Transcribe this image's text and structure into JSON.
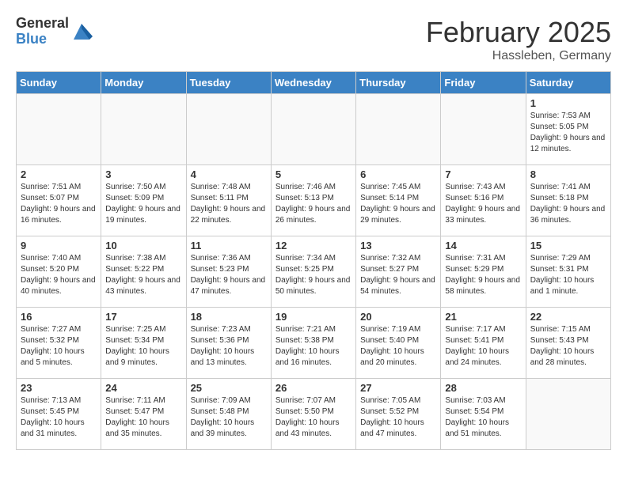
{
  "header": {
    "logo_general": "General",
    "logo_blue": "Blue",
    "month_title": "February 2025",
    "location": "Hassleben, Germany"
  },
  "weekdays": [
    "Sunday",
    "Monday",
    "Tuesday",
    "Wednesday",
    "Thursday",
    "Friday",
    "Saturday"
  ],
  "weeks": [
    [
      {
        "day": "",
        "info": ""
      },
      {
        "day": "",
        "info": ""
      },
      {
        "day": "",
        "info": ""
      },
      {
        "day": "",
        "info": ""
      },
      {
        "day": "",
        "info": ""
      },
      {
        "day": "",
        "info": ""
      },
      {
        "day": "1",
        "info": "Sunrise: 7:53 AM\nSunset: 5:05 PM\nDaylight: 9 hours and 12 minutes."
      }
    ],
    [
      {
        "day": "2",
        "info": "Sunrise: 7:51 AM\nSunset: 5:07 PM\nDaylight: 9 hours and 16 minutes."
      },
      {
        "day": "3",
        "info": "Sunrise: 7:50 AM\nSunset: 5:09 PM\nDaylight: 9 hours and 19 minutes."
      },
      {
        "day": "4",
        "info": "Sunrise: 7:48 AM\nSunset: 5:11 PM\nDaylight: 9 hours and 22 minutes."
      },
      {
        "day": "5",
        "info": "Sunrise: 7:46 AM\nSunset: 5:13 PM\nDaylight: 9 hours and 26 minutes."
      },
      {
        "day": "6",
        "info": "Sunrise: 7:45 AM\nSunset: 5:14 PM\nDaylight: 9 hours and 29 minutes."
      },
      {
        "day": "7",
        "info": "Sunrise: 7:43 AM\nSunset: 5:16 PM\nDaylight: 9 hours and 33 minutes."
      },
      {
        "day": "8",
        "info": "Sunrise: 7:41 AM\nSunset: 5:18 PM\nDaylight: 9 hours and 36 minutes."
      }
    ],
    [
      {
        "day": "9",
        "info": "Sunrise: 7:40 AM\nSunset: 5:20 PM\nDaylight: 9 hours and 40 minutes."
      },
      {
        "day": "10",
        "info": "Sunrise: 7:38 AM\nSunset: 5:22 PM\nDaylight: 9 hours and 43 minutes."
      },
      {
        "day": "11",
        "info": "Sunrise: 7:36 AM\nSunset: 5:23 PM\nDaylight: 9 hours and 47 minutes."
      },
      {
        "day": "12",
        "info": "Sunrise: 7:34 AM\nSunset: 5:25 PM\nDaylight: 9 hours and 50 minutes."
      },
      {
        "day": "13",
        "info": "Sunrise: 7:32 AM\nSunset: 5:27 PM\nDaylight: 9 hours and 54 minutes."
      },
      {
        "day": "14",
        "info": "Sunrise: 7:31 AM\nSunset: 5:29 PM\nDaylight: 9 hours and 58 minutes."
      },
      {
        "day": "15",
        "info": "Sunrise: 7:29 AM\nSunset: 5:31 PM\nDaylight: 10 hours and 1 minute."
      }
    ],
    [
      {
        "day": "16",
        "info": "Sunrise: 7:27 AM\nSunset: 5:32 PM\nDaylight: 10 hours and 5 minutes."
      },
      {
        "day": "17",
        "info": "Sunrise: 7:25 AM\nSunset: 5:34 PM\nDaylight: 10 hours and 9 minutes."
      },
      {
        "day": "18",
        "info": "Sunrise: 7:23 AM\nSunset: 5:36 PM\nDaylight: 10 hours and 13 minutes."
      },
      {
        "day": "19",
        "info": "Sunrise: 7:21 AM\nSunset: 5:38 PM\nDaylight: 10 hours and 16 minutes."
      },
      {
        "day": "20",
        "info": "Sunrise: 7:19 AM\nSunset: 5:40 PM\nDaylight: 10 hours and 20 minutes."
      },
      {
        "day": "21",
        "info": "Sunrise: 7:17 AM\nSunset: 5:41 PM\nDaylight: 10 hours and 24 minutes."
      },
      {
        "day": "22",
        "info": "Sunrise: 7:15 AM\nSunset: 5:43 PM\nDaylight: 10 hours and 28 minutes."
      }
    ],
    [
      {
        "day": "23",
        "info": "Sunrise: 7:13 AM\nSunset: 5:45 PM\nDaylight: 10 hours and 31 minutes."
      },
      {
        "day": "24",
        "info": "Sunrise: 7:11 AM\nSunset: 5:47 PM\nDaylight: 10 hours and 35 minutes."
      },
      {
        "day": "25",
        "info": "Sunrise: 7:09 AM\nSunset: 5:48 PM\nDaylight: 10 hours and 39 minutes."
      },
      {
        "day": "26",
        "info": "Sunrise: 7:07 AM\nSunset: 5:50 PM\nDaylight: 10 hours and 43 minutes."
      },
      {
        "day": "27",
        "info": "Sunrise: 7:05 AM\nSunset: 5:52 PM\nDaylight: 10 hours and 47 minutes."
      },
      {
        "day": "28",
        "info": "Sunrise: 7:03 AM\nSunset: 5:54 PM\nDaylight: 10 hours and 51 minutes."
      },
      {
        "day": "",
        "info": ""
      }
    ]
  ]
}
